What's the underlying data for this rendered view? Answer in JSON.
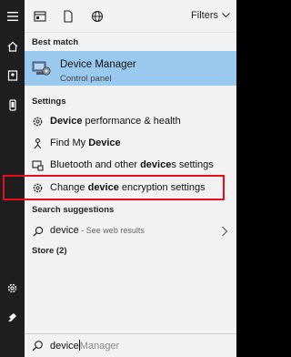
{
  "filters": {
    "label": "Filters"
  },
  "sections": {
    "best_match": "Best match",
    "settings": "Settings",
    "search_suggestions": "Search suggestions",
    "store": "Store (2)"
  },
  "best_match_item": {
    "title": "Device Manager",
    "subtitle": "Control panel"
  },
  "settings_items": [
    {
      "bold": "Device",
      "rest": " performance & health"
    },
    {
      "plain": "Find My ",
      "bold": "Device"
    },
    {
      "plain": "Bluetooth and other ",
      "bold": "device",
      "rest": "s settings"
    },
    {
      "plain": "Change ",
      "bold": "device",
      "rest": " encryption settings"
    }
  ],
  "suggestion": {
    "term": "device",
    "hint": " - See web results"
  },
  "search": {
    "typed": "device",
    "ghost": "Manager"
  },
  "colors": {
    "selected": "#99c9ef",
    "highlight_border": "#e4101c",
    "panel_bg": "#f2f2f2",
    "rail_bg": "#1f1f1f"
  },
  "icons": {
    "rail": [
      "hamburger-icon",
      "home-icon",
      "notebook-icon",
      "phone-icon",
      "gear-icon",
      "user-icon"
    ],
    "filters": [
      "apps-icon",
      "document-icon",
      "web-globe-icon"
    ],
    "settings": [
      "gear-icon",
      "person-icon",
      "keyboard-icon",
      "gear-icon"
    ]
  }
}
